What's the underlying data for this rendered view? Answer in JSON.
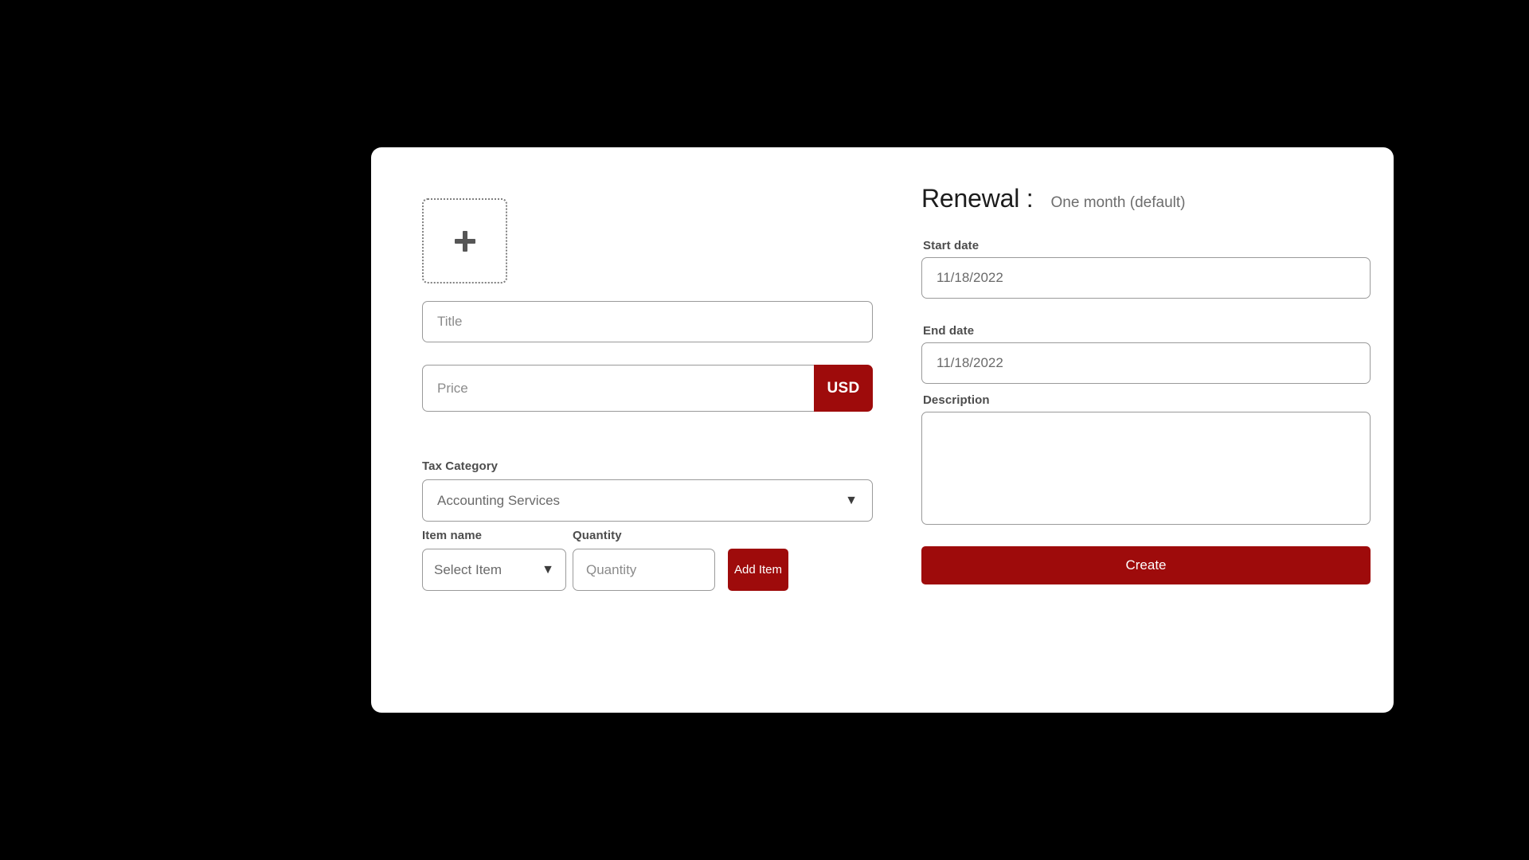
{
  "card": {
    "left_column": {
      "upload": {
        "icon": "plus-icon",
        "aria_label": "Add image"
      },
      "title_field": {
        "placeholder": "Title",
        "value": ""
      },
      "price_field": {
        "placeholder": "Price",
        "value": "",
        "currency": "USD"
      },
      "tax_category": {
        "label": "Tax Category",
        "selected": "Accounting Services",
        "caret": "▼"
      },
      "item_name": {
        "label": "Item name",
        "selected": "Select Item",
        "caret": "▼"
      },
      "quantity": {
        "label": "Quantity",
        "placeholder": "Quantity",
        "value": ""
      },
      "add_item_button": "Add Item"
    },
    "right_column": {
      "renewal": {
        "title": "Renewal :",
        "value": "One month (default)"
      },
      "start_date": {
        "label": "Start date",
        "value": "11/18/2022"
      },
      "end_date": {
        "label": "End date",
        "value": "11/18/2022"
      },
      "description": {
        "label": "Description",
        "value": "",
        "placeholder": ""
      },
      "create_button": "Create"
    }
  },
  "colors": {
    "accent_red": "#9e0b0b",
    "card_background": "#ffffff",
    "page_background": "#000000",
    "field_border": "#9a9a9a",
    "placeholder_text": "#8b8b8b",
    "label_text": "#4d4d4d"
  }
}
